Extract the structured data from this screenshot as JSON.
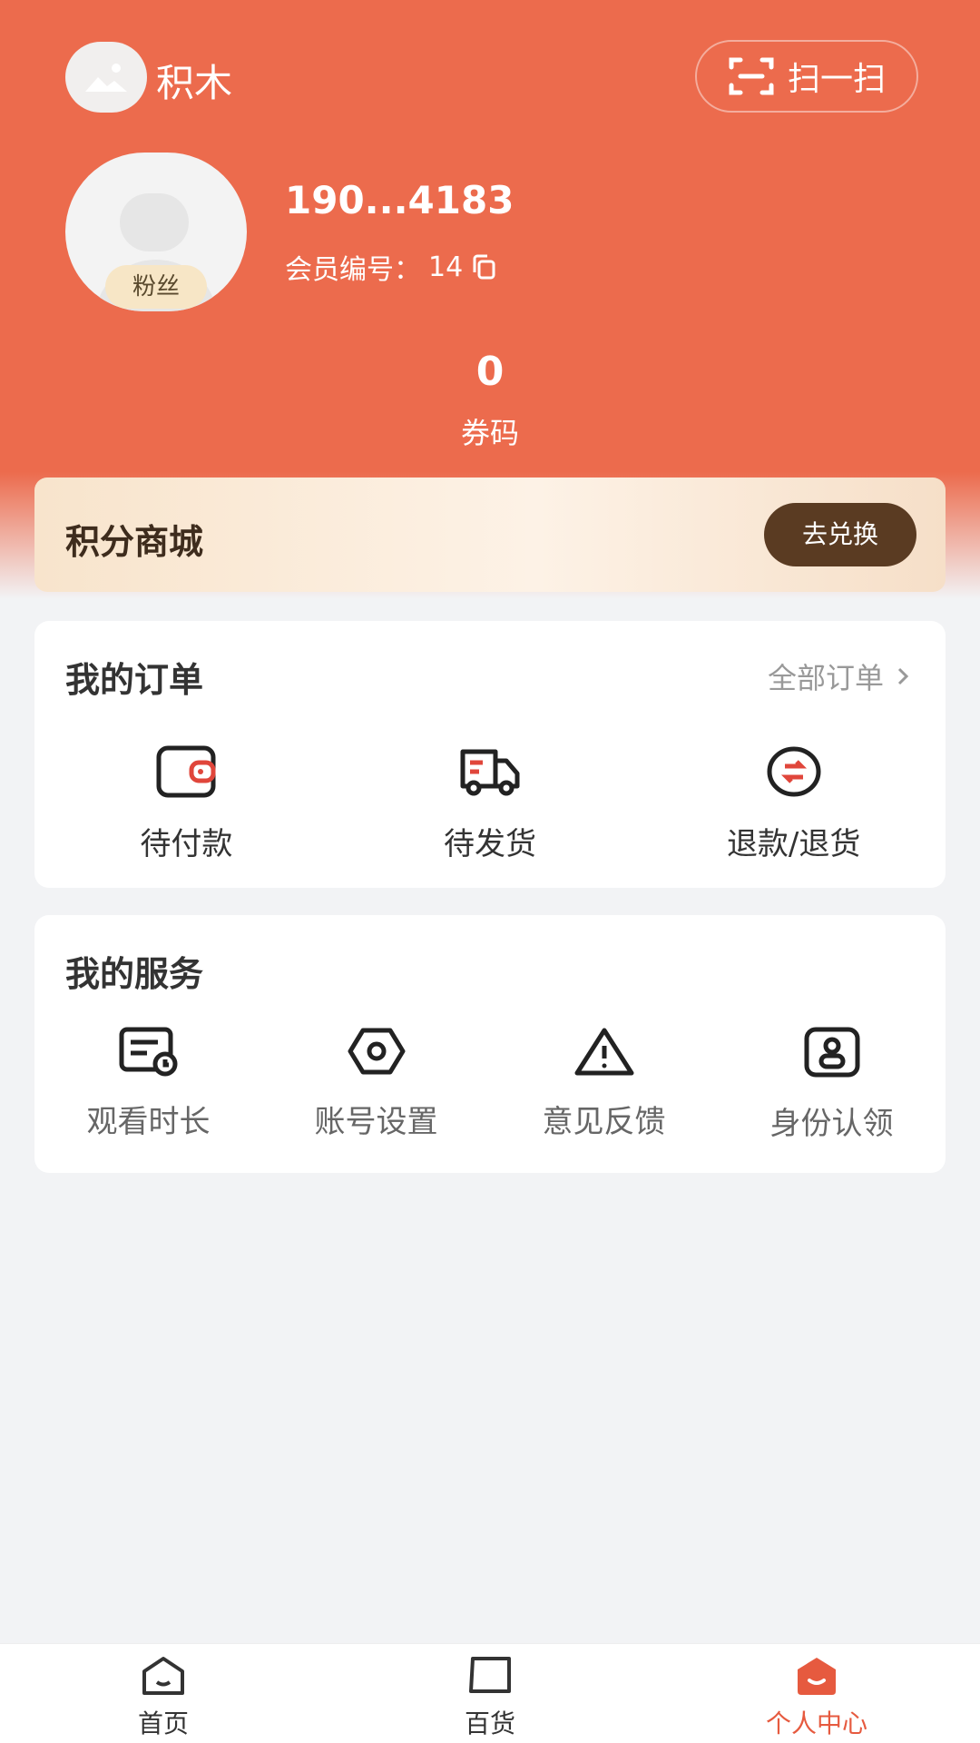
{
  "brand": {
    "name": "积木",
    "scan_label": "扫一扫"
  },
  "profile": {
    "phone": "190...4183",
    "member_label": "会员编号：",
    "member_id": "14",
    "fans_badge": "粉丝",
    "coupon_count": "0",
    "coupon_label": "券码"
  },
  "points_mall": {
    "title": "积分商城",
    "button": "去兑换"
  },
  "orders": {
    "title": "我的订单",
    "all_label": "全部订单",
    "items": [
      {
        "label": "待付款",
        "icon": "wallet-icon"
      },
      {
        "label": "待发货",
        "icon": "truck-icon"
      },
      {
        "label": "退款/退货",
        "icon": "refund-icon"
      }
    ]
  },
  "services": {
    "title": "我的服务",
    "items": [
      {
        "label": "观看时长",
        "icon": "watch-time-icon"
      },
      {
        "label": "账号设置",
        "icon": "settings-icon"
      },
      {
        "label": "意见反馈",
        "icon": "warning-icon"
      },
      {
        "label": "身份认领",
        "icon": "id-card-icon"
      }
    ]
  },
  "tabbar": {
    "items": [
      {
        "label": "首页",
        "icon": "home-icon"
      },
      {
        "label": "百货",
        "icon": "store-icon"
      },
      {
        "label": "个人中心",
        "icon": "profile-icon",
        "active": true
      }
    ]
  },
  "colors": {
    "primary": "#ec6b4d",
    "active_tab": "#e65a3f",
    "redeem_button": "#5a3b22",
    "background": "#f2f3f5"
  }
}
